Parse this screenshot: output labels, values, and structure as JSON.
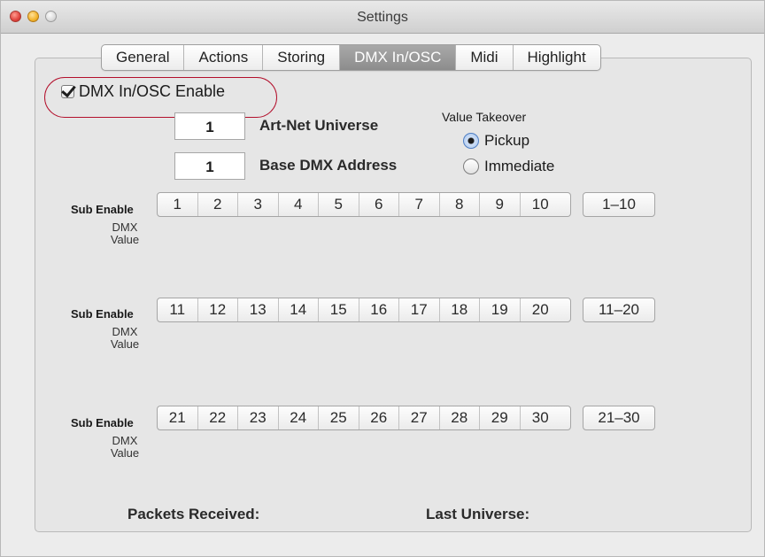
{
  "window": {
    "title": "Settings"
  },
  "tabs": [
    {
      "label": "General"
    },
    {
      "label": "Actions"
    },
    {
      "label": "Storing"
    },
    {
      "label": "DMX In/OSC"
    },
    {
      "label": "Midi"
    },
    {
      "label": "Highlight"
    }
  ],
  "active_tab": "DMX In/OSC",
  "dmx": {
    "enable_label": "DMX In/OSC Enable",
    "enable_checked": true,
    "universe_value": "1",
    "universe_label": "Art-Net Universe",
    "base_value": "1",
    "base_label": "Base DMX Address"
  },
  "value_takeover": {
    "title": "Value Takeover",
    "options": [
      {
        "label": "Pickup",
        "selected": true
      },
      {
        "label": "Immediate",
        "selected": false
      }
    ]
  },
  "sub_groups": [
    {
      "sub_label": "Sub Enable",
      "dmx_label": "DMX",
      "value_label": "Value",
      "numbers": [
        "1",
        "2",
        "3",
        "4",
        "5",
        "6",
        "7",
        "8",
        "9",
        "10"
      ],
      "range": "1–10"
    },
    {
      "sub_label": "Sub Enable",
      "dmx_label": "DMX",
      "value_label": "Value",
      "numbers": [
        "11",
        "12",
        "13",
        "14",
        "15",
        "16",
        "17",
        "18",
        "19",
        "20"
      ],
      "range": "11–20"
    },
    {
      "sub_label": "Sub Enable",
      "dmx_label": "DMX",
      "value_label": "Value",
      "numbers": [
        "21",
        "22",
        "23",
        "24",
        "25",
        "26",
        "27",
        "28",
        "29",
        "30"
      ],
      "range": "21–30"
    }
  ],
  "status": {
    "packets_label": "Packets Received:",
    "last_universe_label": "Last Universe:"
  },
  "colors": {
    "highlight_oval": "#b3102c",
    "active_tab": "#9a9a9a"
  }
}
